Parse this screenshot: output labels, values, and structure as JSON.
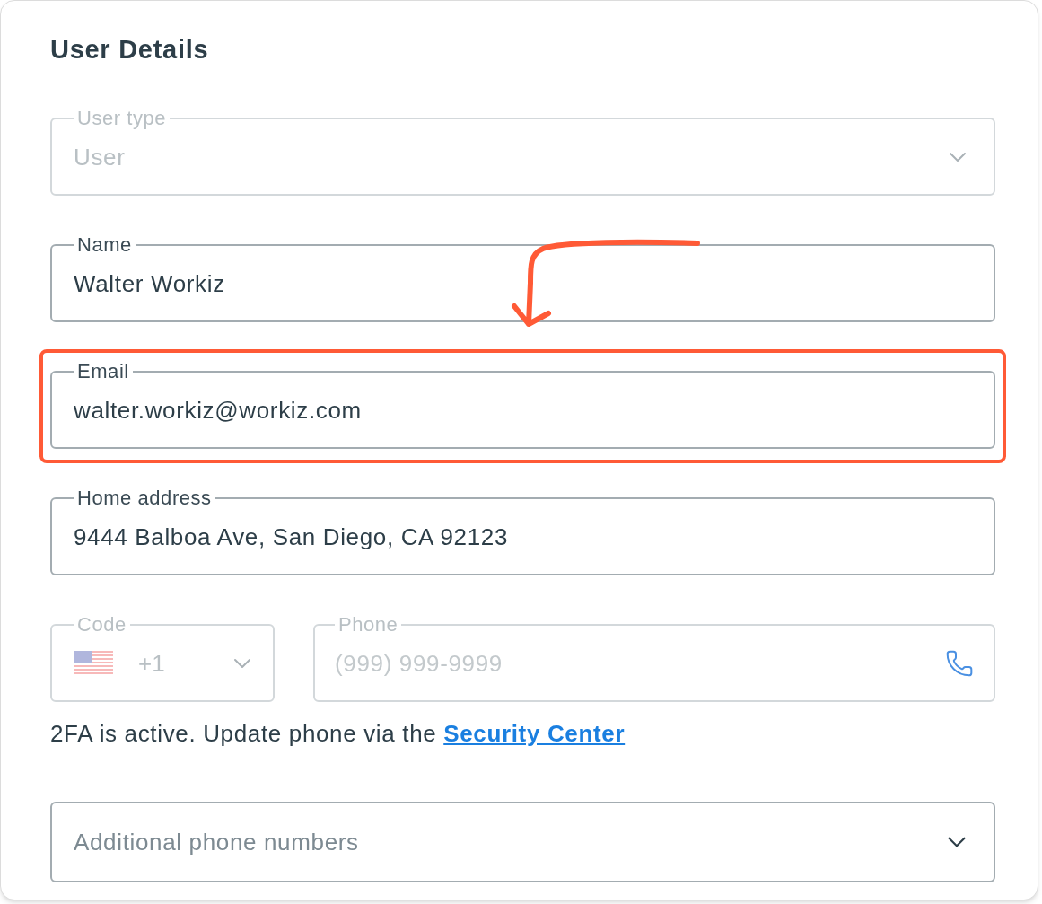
{
  "title": "User Details",
  "fields": [
    {
      "kind": "select",
      "label": "User type",
      "value": "User",
      "disabled": true,
      "highlighted": false
    },
    {
      "kind": "text",
      "label": "Name",
      "value": "Walter Workiz",
      "disabled": false,
      "highlighted": false
    },
    {
      "kind": "text",
      "label": "Email",
      "value": "walter.workiz@workiz.com",
      "disabled": false,
      "highlighted": true
    },
    {
      "kind": "text",
      "label": "Home address",
      "value": "9444 Balboa Ave, San Diego, CA 92123",
      "disabled": false,
      "highlighted": false
    }
  ],
  "phone_row": {
    "code": {
      "label": "Code",
      "value": "+1",
      "disabled": true
    },
    "phone": {
      "label": "Phone",
      "placeholder": "(999) 999-9999",
      "disabled": true
    }
  },
  "note": {
    "text": "2FA is active. Update phone via the",
    "link": "Security Center"
  },
  "additional": {
    "placeholder": "Additional phone numbers"
  }
}
